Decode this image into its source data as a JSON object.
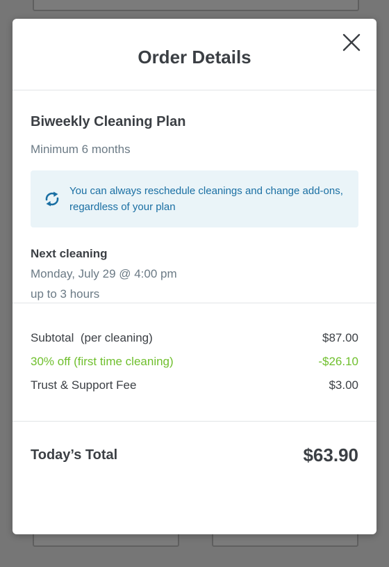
{
  "modal": {
    "title": "Order Details",
    "close_icon": "close-icon"
  },
  "plan": {
    "name": "Biweekly Cleaning Plan",
    "minimum": "Minimum 6 months",
    "info_icon": "refresh-icon",
    "info_text": "You can always reschedule cleanings and change add-ons, regardless of your plan"
  },
  "next_cleaning": {
    "label": "Next cleaning",
    "date": "Monday, July 29 @ 4:00 pm",
    "duration": "up to 3 hours"
  },
  "costs": [
    {
      "label": "Subtotal  (per cleaning)",
      "value": "$87.00"
    },
    {
      "label": "30% off (first time cleaning)",
      "value": "-$26.10"
    },
    {
      "label": "Trust & Support Fee",
      "value": "$3.00"
    }
  ],
  "total": {
    "label": "Today’s Total",
    "value": "$63.90"
  },
  "colors": {
    "accent_blue": "#1a6fa3",
    "discount_green": "#6fbf2d",
    "info_bg": "#eaf4f8",
    "text_dark": "#3b3f44",
    "text_muted": "#6b7a85"
  }
}
